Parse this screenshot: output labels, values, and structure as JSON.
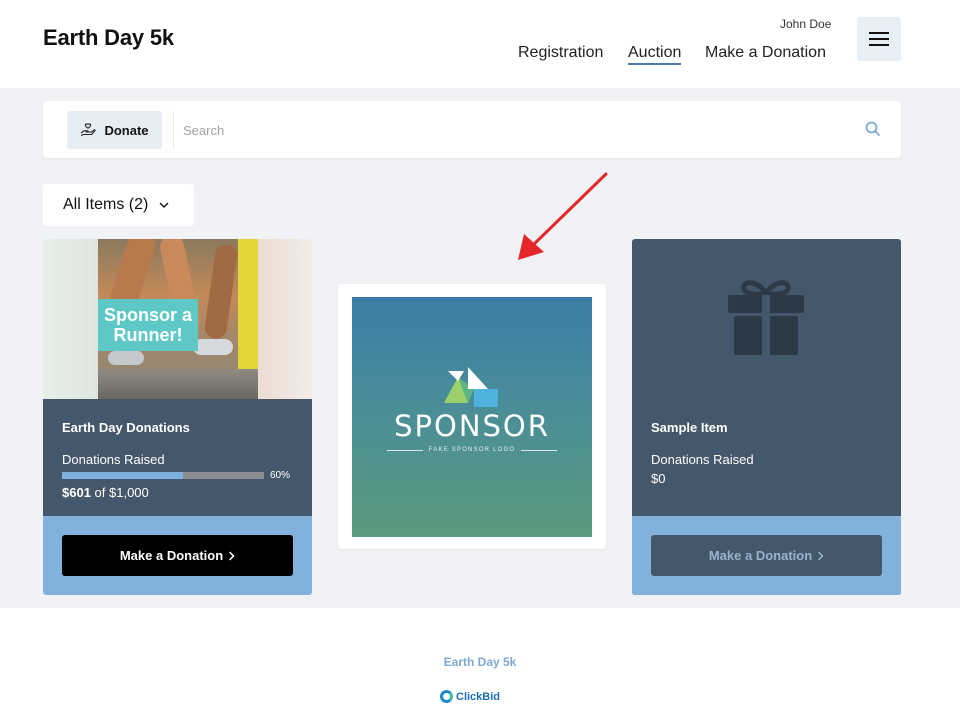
{
  "header": {
    "site_title": "Earth Day 5k",
    "user_name": "John Doe",
    "nav": [
      {
        "label": "Registration",
        "active": false
      },
      {
        "label": "Auction",
        "active": true
      },
      {
        "label": "Make a Donation",
        "active": false
      }
    ],
    "menu_icon": "hamburger-icon"
  },
  "toolbar": {
    "donate_label": "Donate",
    "donate_icon": "hand-heart-icon",
    "search_placeholder": "Search",
    "search_value": "",
    "search_icon": "search-icon"
  },
  "filter": {
    "label": "All Items (2)",
    "icon": "chevron-down-icon"
  },
  "items": [
    {
      "image_text": "Sponsor a Runner!",
      "title": "Earth Day Donations",
      "raised_label": "Donations Raised",
      "progress_percent": 60,
      "progress_label": "60%",
      "raised_value": "$601",
      "raised_of": "of $1,000",
      "cta_label": "Make a Donation"
    },
    {
      "title": "Sample Item",
      "raised_label": "Donations Raised",
      "raised_value": "$0",
      "cta_label": "Make a Donation",
      "icon": "gift-icon"
    }
  ],
  "sponsor": {
    "word": "SPONSOR",
    "tagline": "FAKE SPONSOR LOGO"
  },
  "footer": {
    "event_name": "Earth Day 5k",
    "brand": "ClickBid"
  },
  "colors": {
    "card_dark": "#44576b",
    "card_footer": "#82b2db",
    "accent_arrow": "#e5262b",
    "progress_fill": "#7fb0dd"
  }
}
